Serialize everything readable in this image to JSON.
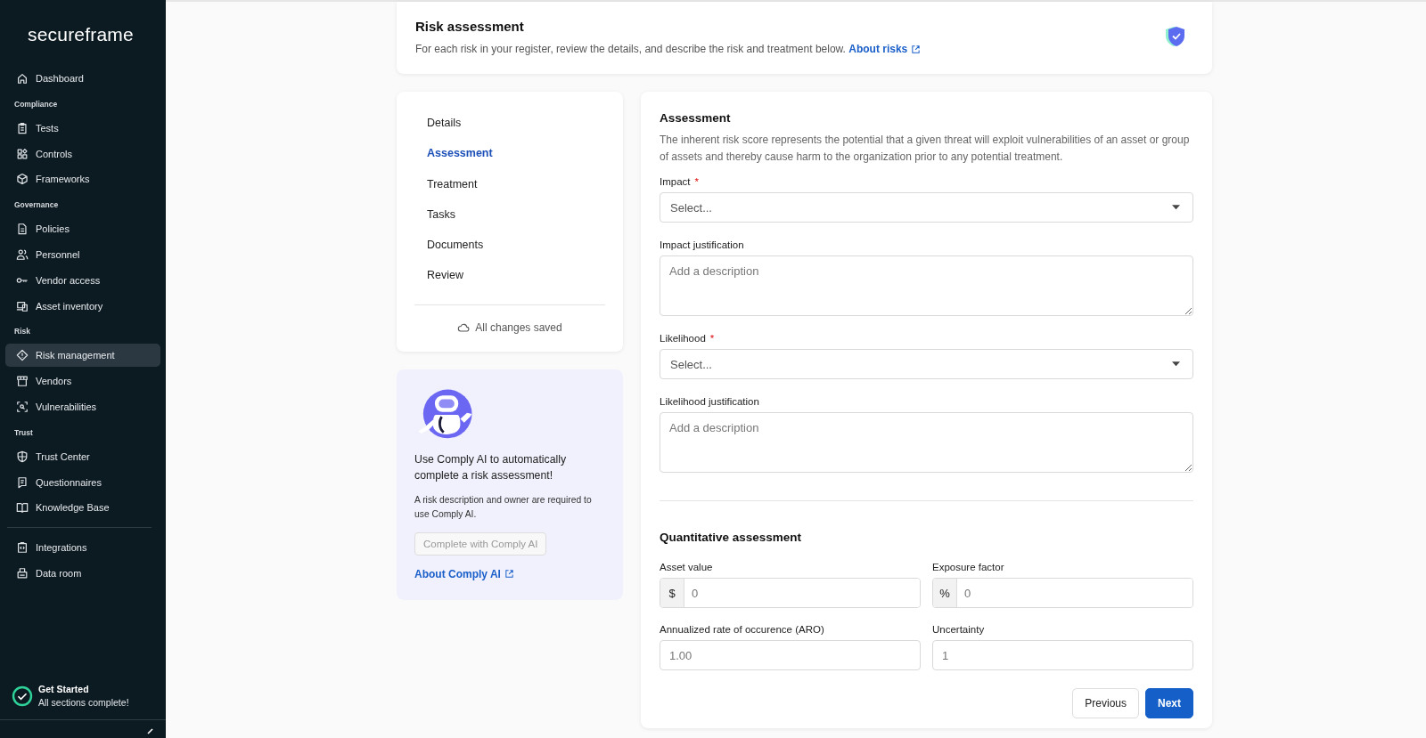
{
  "sidebar": {
    "logo": "secureframe",
    "groups": [
      {
        "items": [
          {
            "label": "Dashboard",
            "selected": false
          }
        ]
      },
      {
        "heading": "Compliance",
        "items": [
          {
            "label": "Tests",
            "selected": false
          },
          {
            "label": "Controls",
            "selected": false
          },
          {
            "label": "Frameworks",
            "selected": false
          }
        ]
      },
      {
        "heading": "Governance",
        "items": [
          {
            "label": "Policies",
            "selected": false
          },
          {
            "label": "Personnel",
            "selected": false
          },
          {
            "label": "Vendor access",
            "selected": false
          },
          {
            "label": "Asset inventory",
            "selected": false
          }
        ]
      },
      {
        "heading": "Risk",
        "items": [
          {
            "label": "Risk management",
            "selected": true
          },
          {
            "label": "Vendors",
            "selected": false
          },
          {
            "label": "Vulnerabilities",
            "selected": false
          }
        ]
      },
      {
        "heading": "Trust",
        "items": [
          {
            "label": "Trust Center",
            "selected": false
          },
          {
            "label": "Questionnaires",
            "selected": false
          },
          {
            "label": "Knowledge Base",
            "selected": false
          }
        ]
      },
      {
        "items": [
          {
            "label": "Integrations",
            "selected": false
          },
          {
            "label": "Data room",
            "selected": false
          }
        ]
      }
    ],
    "get_started": {
      "title": "Get Started",
      "subtitle": "All sections complete!",
      "checked": true
    }
  },
  "header": {
    "title": "Risk assessment",
    "description": "For each risk in your register, review the details, and describe the risk and treatment below.",
    "link": "About risks"
  },
  "steps": {
    "items": [
      {
        "label": "Details",
        "selected": false
      },
      {
        "label": "Assessment",
        "selected": true
      },
      {
        "label": "Treatment",
        "selected": false
      },
      {
        "label": "Tasks",
        "selected": false
      },
      {
        "label": "Documents",
        "selected": false
      },
      {
        "label": "Review",
        "selected": false
      }
    ],
    "save_status": "All changes saved"
  },
  "ai_card": {
    "title": "Use Comply AI to automatically complete a risk assessment!",
    "note": "A risk description and owner are required to use Comply AI.",
    "button": {
      "label": "Complete with Comply AI",
      "disabled": true
    },
    "link": "About Comply AI"
  },
  "form": {
    "sections": [
      {
        "title": "Assessment",
        "description": "The inherent risk score represents the potential that a given threat will exploit vulnerabilities of an asset or group of assets and thereby cause harm to the organization prior to any potential treatment.",
        "kind": "stack",
        "fields": [
          {
            "kind": "select",
            "label": "Impact",
            "required_mark": "*",
            "placeholder": "Select..."
          },
          {
            "kind": "textarea",
            "label": "Impact justification",
            "placeholder": "Add a description"
          },
          {
            "kind": "select",
            "label": "Likelihood",
            "required_mark": "*",
            "placeholder": "Select..."
          },
          {
            "kind": "textarea",
            "label": "Likelihood justification",
            "placeholder": "Add a description"
          }
        ]
      },
      {
        "title": "Quantitative assessment",
        "kind": "grid",
        "fields": [
          {
            "kind": "affix",
            "label": "Asset value",
            "prefix": "$",
            "placeholder": "0"
          },
          {
            "kind": "affix",
            "label": "Exposure factor",
            "prefix": "%",
            "placeholder": "0"
          },
          {
            "kind": "text",
            "label": "Annualized rate of occurence (ARO)",
            "placeholder": "1.00"
          },
          {
            "kind": "text",
            "label": "Uncertainty",
            "placeholder": "1"
          }
        ]
      }
    ],
    "buttons": [
      {
        "label": "Previous",
        "kind": "secondary"
      },
      {
        "label": "Next",
        "kind": "primary"
      }
    ]
  }
}
